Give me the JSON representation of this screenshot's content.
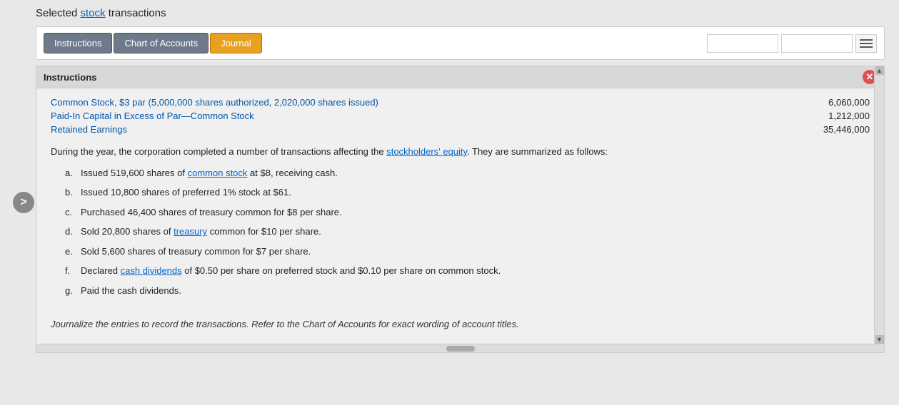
{
  "header": {
    "prefix": "Selected ",
    "link_text": "stock",
    "suffix": " transactions"
  },
  "tabs": [
    {
      "id": "instructions",
      "label": "Instructions",
      "active": false
    },
    {
      "id": "chart-of-accounts",
      "label": "Chart of Accounts",
      "active": false
    },
    {
      "id": "journal",
      "label": "Journal",
      "active": true
    }
  ],
  "search": {
    "placeholder": "",
    "value": ""
  },
  "instructions_panel": {
    "title": "Instructions",
    "accounts": [
      {
        "name": "Common Stock, $3 par (5,000,000 shares authorized, 2,020,000 shares issued)",
        "value": "6,060,000"
      },
      {
        "name": "Paid-In Capital in Excess of Par—Common Stock",
        "value": "1,212,000"
      },
      {
        "name": "Retained Earnings",
        "value": "35,446,000"
      }
    ],
    "description": "During the year, the corporation completed a number of transactions affecting the stockholders' equity. They are summarized as follows:",
    "description_link": "stockholders' equity",
    "transactions": [
      {
        "label": "a.",
        "text": "Issued 519,600 shares of common stock at $8, receiving cash.",
        "link": "common stock"
      },
      {
        "label": "b.",
        "text": "Issued 10,800 shares of preferred 1% stock at $61."
      },
      {
        "label": "c.",
        "text": "Purchased 46,400 shares of treasury common for $8 per share."
      },
      {
        "label": "d.",
        "text": "Sold 20,800 shares of treasury common for $10 per share.",
        "link": "treasury"
      },
      {
        "label": "e.",
        "text": "Sold 5,600 shares of treasury common for $7 per share."
      },
      {
        "label": "f.",
        "text": "Declared cash dividends of $0.50 per share on preferred stock and $0.10 per share on common stock.",
        "link": "cash dividends"
      },
      {
        "label": "g.",
        "text": "Paid the cash dividends."
      }
    ],
    "footer_text": "Journalize the entries to record the transactions. Refer to the Chart of Accounts for exact wording of account titles."
  }
}
